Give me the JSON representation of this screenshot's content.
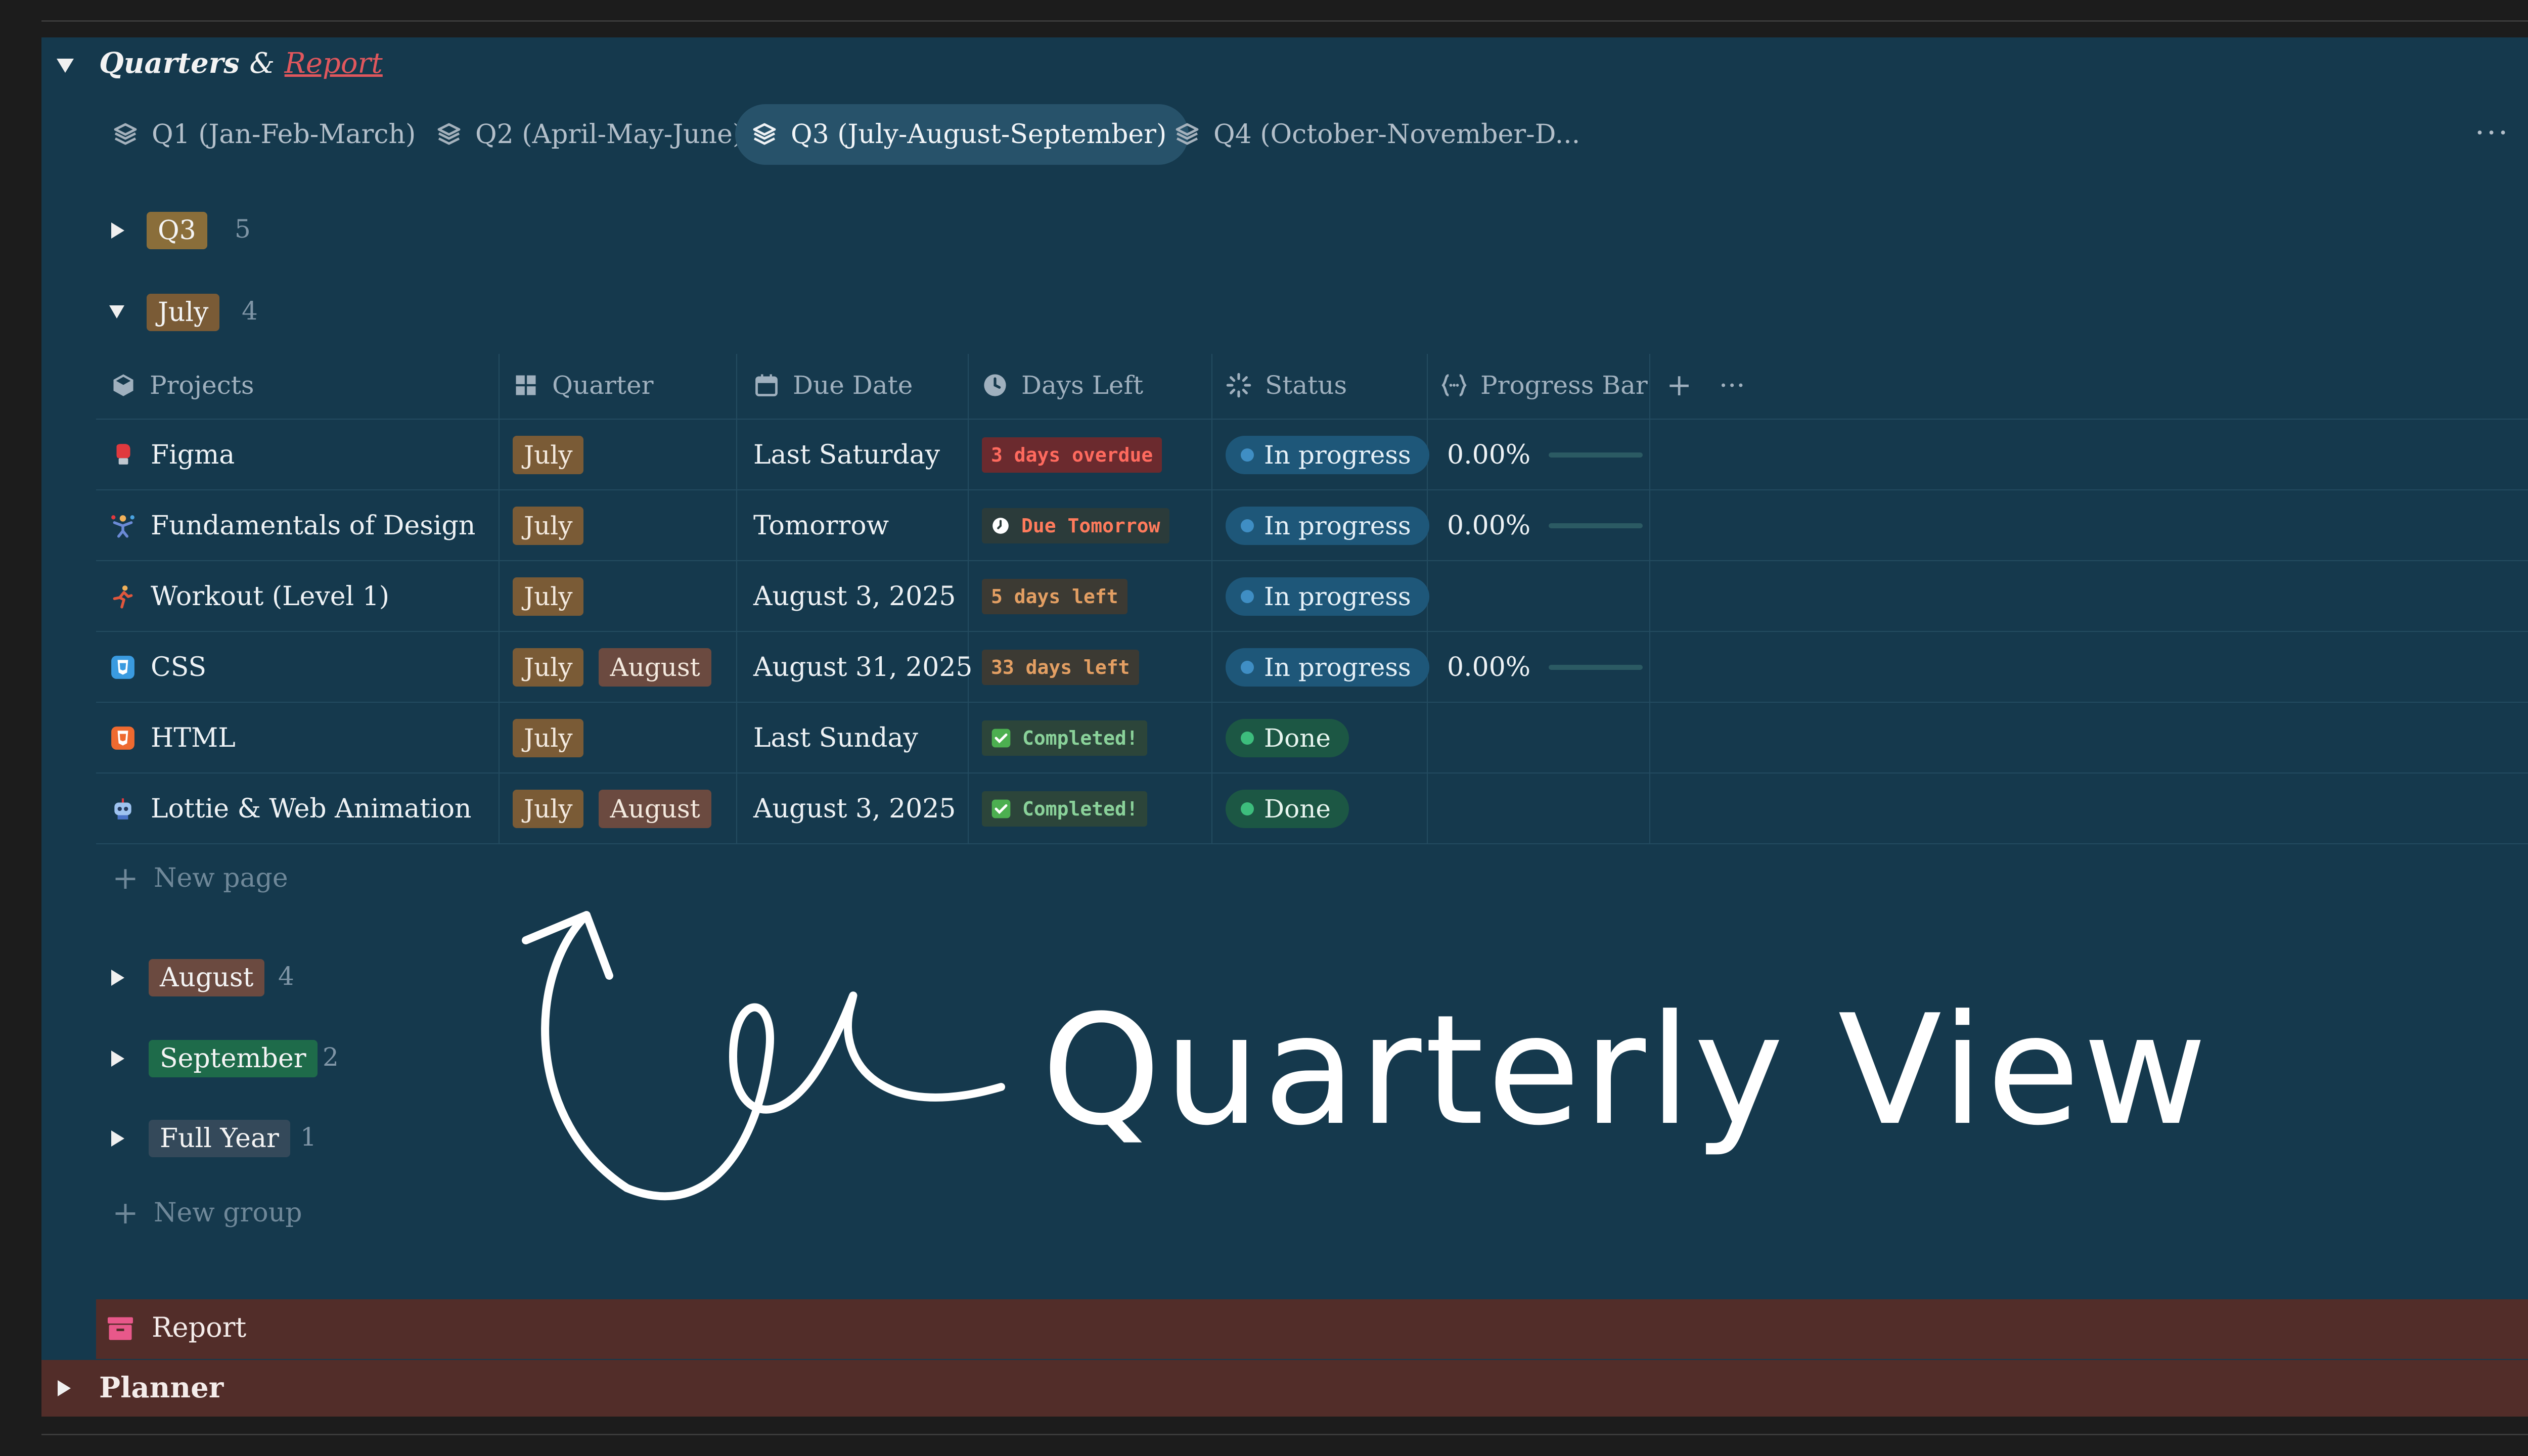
{
  "section": {
    "title_main": "Quarters",
    "title_amp": "&",
    "title_link": "Report"
  },
  "tabs": [
    {
      "label": "Q1 (Jan-Feb-March)",
      "active": false
    },
    {
      "label": "Q2 (April-May-June)",
      "active": false
    },
    {
      "label": "Q3 (July-August-September)",
      "active": true
    },
    {
      "label": "Q4 (October-November-D...",
      "active": false
    }
  ],
  "tabs_more": "···",
  "groups": {
    "q3": {
      "label": "Q3",
      "count": "5",
      "color": "#8a6e3a"
    },
    "july": {
      "label": "July",
      "count": "4",
      "color": "#7a5b36"
    },
    "august": {
      "label": "August",
      "count": "4",
      "color": "#6b4a40"
    },
    "september": {
      "label": "September",
      "count": "2",
      "color": "#1e6b4a"
    },
    "full_year": {
      "label": "Full Year",
      "count": "1",
      "color": "#34495a"
    }
  },
  "columns": {
    "projects": "Projects",
    "quarter": "Quarter",
    "due_date": "Due Date",
    "days_left": "Days Left",
    "status": "Status",
    "progress": "Progress Bar",
    "add": "+",
    "more": "···"
  },
  "rows": [
    {
      "name": "Figma",
      "icon": "boxing-glove-icon",
      "quarters": [
        "July"
      ],
      "due": "Last Saturday",
      "days": "3 days overdue",
      "days_style": "red",
      "days_icon": "",
      "status": "In progress",
      "progress": "0.00%",
      "progress_value": 0
    },
    {
      "name": "Fundamentals of Design",
      "icon": "juggler-icon",
      "quarters": [
        "July"
      ],
      "due": "Tomorrow",
      "days": "Due Tomorrow",
      "days_style": "dark",
      "days_icon": "clock-icon",
      "status": "In progress",
      "progress": "0.00%",
      "progress_value": 0
    },
    {
      "name": "Workout (Level 1)",
      "icon": "runner-icon",
      "quarters": [
        "July"
      ],
      "due": "August 3, 2025",
      "days": "5 days left",
      "days_style": "brown",
      "days_icon": "",
      "status": "In progress",
      "progress": "",
      "progress_value": null
    },
    {
      "name": "CSS",
      "icon": "css-icon",
      "quarters": [
        "July",
        "August"
      ],
      "due": "August 31, 2025",
      "days": "33 days left",
      "days_style": "brown",
      "days_icon": "",
      "status": "In progress",
      "progress": "0.00%",
      "progress_value": 0
    },
    {
      "name": "HTML",
      "icon": "html-icon",
      "quarters": [
        "July"
      ],
      "due": "Last Sunday",
      "days": "Completed!",
      "days_style": "green",
      "days_icon": "check-icon",
      "status": "Done",
      "progress": "",
      "progress_value": null
    },
    {
      "name": "Lottie & Web Animation",
      "icon": "robot-icon",
      "quarters": [
        "July",
        "August"
      ],
      "due": "August 3, 2025",
      "days": "Completed!",
      "days_style": "green",
      "days_icon": "check-icon",
      "status": "Done",
      "progress": "",
      "progress_value": null
    }
  ],
  "new_page": "New page",
  "new_group": "New group",
  "annotation": "Quarterly View",
  "report_label": "Report",
  "planner_label": "Planner",
  "colors": {
    "panel": "#15394d",
    "accent_red": "#e0575d",
    "in_progress": "#1e5779",
    "done": "#1c5744",
    "report_bar": "#522d29"
  }
}
